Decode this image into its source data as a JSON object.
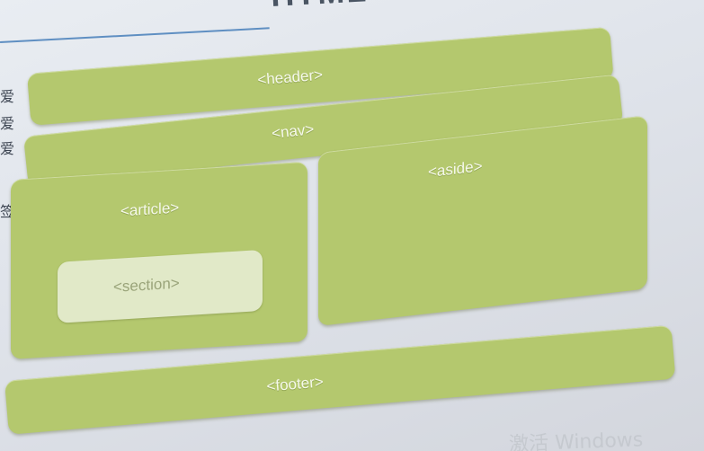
{
  "slide": {
    "title": "HTML"
  },
  "side_glyphs": [
    "爱",
    "爱",
    "爱",
    "签"
  ],
  "blocks": {
    "header": "<header>",
    "nav": "<nav>",
    "article": "<article>",
    "section": "<section>",
    "aside": "<aside>",
    "footer": "<footer>"
  },
  "watermark": "激活 Windows",
  "colors": {
    "block": "#b4c86e",
    "section": "#e1e9c8",
    "label": "#f5f8ea",
    "background": "#e2e6ec"
  }
}
